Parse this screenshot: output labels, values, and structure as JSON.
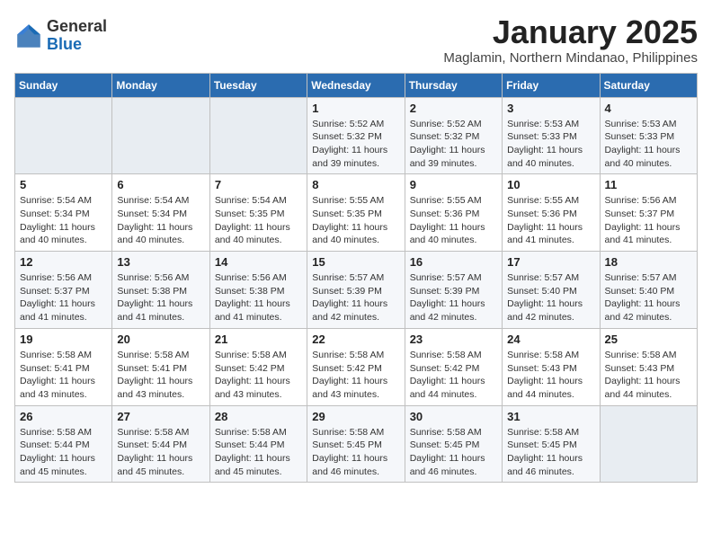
{
  "header": {
    "logo_general": "General",
    "logo_blue": "Blue",
    "month_title": "January 2025",
    "location": "Maglamin, Northern Mindanao, Philippines"
  },
  "days_of_week": [
    "Sunday",
    "Monday",
    "Tuesday",
    "Wednesday",
    "Thursday",
    "Friday",
    "Saturday"
  ],
  "weeks": [
    [
      {
        "day": "",
        "detail": ""
      },
      {
        "day": "",
        "detail": ""
      },
      {
        "day": "",
        "detail": ""
      },
      {
        "day": "1",
        "detail": "Sunrise: 5:52 AM\nSunset: 5:32 PM\nDaylight: 11 hours\nand 39 minutes."
      },
      {
        "day": "2",
        "detail": "Sunrise: 5:52 AM\nSunset: 5:32 PM\nDaylight: 11 hours\nand 39 minutes."
      },
      {
        "day": "3",
        "detail": "Sunrise: 5:53 AM\nSunset: 5:33 PM\nDaylight: 11 hours\nand 40 minutes."
      },
      {
        "day": "4",
        "detail": "Sunrise: 5:53 AM\nSunset: 5:33 PM\nDaylight: 11 hours\nand 40 minutes."
      }
    ],
    [
      {
        "day": "5",
        "detail": "Sunrise: 5:54 AM\nSunset: 5:34 PM\nDaylight: 11 hours\nand 40 minutes."
      },
      {
        "day": "6",
        "detail": "Sunrise: 5:54 AM\nSunset: 5:34 PM\nDaylight: 11 hours\nand 40 minutes."
      },
      {
        "day": "7",
        "detail": "Sunrise: 5:54 AM\nSunset: 5:35 PM\nDaylight: 11 hours\nand 40 minutes."
      },
      {
        "day": "8",
        "detail": "Sunrise: 5:55 AM\nSunset: 5:35 PM\nDaylight: 11 hours\nand 40 minutes."
      },
      {
        "day": "9",
        "detail": "Sunrise: 5:55 AM\nSunset: 5:36 PM\nDaylight: 11 hours\nand 40 minutes."
      },
      {
        "day": "10",
        "detail": "Sunrise: 5:55 AM\nSunset: 5:36 PM\nDaylight: 11 hours\nand 41 minutes."
      },
      {
        "day": "11",
        "detail": "Sunrise: 5:56 AM\nSunset: 5:37 PM\nDaylight: 11 hours\nand 41 minutes."
      }
    ],
    [
      {
        "day": "12",
        "detail": "Sunrise: 5:56 AM\nSunset: 5:37 PM\nDaylight: 11 hours\nand 41 minutes."
      },
      {
        "day": "13",
        "detail": "Sunrise: 5:56 AM\nSunset: 5:38 PM\nDaylight: 11 hours\nand 41 minutes."
      },
      {
        "day": "14",
        "detail": "Sunrise: 5:56 AM\nSunset: 5:38 PM\nDaylight: 11 hours\nand 41 minutes."
      },
      {
        "day": "15",
        "detail": "Sunrise: 5:57 AM\nSunset: 5:39 PM\nDaylight: 11 hours\nand 42 minutes."
      },
      {
        "day": "16",
        "detail": "Sunrise: 5:57 AM\nSunset: 5:39 PM\nDaylight: 11 hours\nand 42 minutes."
      },
      {
        "day": "17",
        "detail": "Sunrise: 5:57 AM\nSunset: 5:40 PM\nDaylight: 11 hours\nand 42 minutes."
      },
      {
        "day": "18",
        "detail": "Sunrise: 5:57 AM\nSunset: 5:40 PM\nDaylight: 11 hours\nand 42 minutes."
      }
    ],
    [
      {
        "day": "19",
        "detail": "Sunrise: 5:58 AM\nSunset: 5:41 PM\nDaylight: 11 hours\nand 43 minutes."
      },
      {
        "day": "20",
        "detail": "Sunrise: 5:58 AM\nSunset: 5:41 PM\nDaylight: 11 hours\nand 43 minutes."
      },
      {
        "day": "21",
        "detail": "Sunrise: 5:58 AM\nSunset: 5:42 PM\nDaylight: 11 hours\nand 43 minutes."
      },
      {
        "day": "22",
        "detail": "Sunrise: 5:58 AM\nSunset: 5:42 PM\nDaylight: 11 hours\nand 43 minutes."
      },
      {
        "day": "23",
        "detail": "Sunrise: 5:58 AM\nSunset: 5:42 PM\nDaylight: 11 hours\nand 44 minutes."
      },
      {
        "day": "24",
        "detail": "Sunrise: 5:58 AM\nSunset: 5:43 PM\nDaylight: 11 hours\nand 44 minutes."
      },
      {
        "day": "25",
        "detail": "Sunrise: 5:58 AM\nSunset: 5:43 PM\nDaylight: 11 hours\nand 44 minutes."
      }
    ],
    [
      {
        "day": "26",
        "detail": "Sunrise: 5:58 AM\nSunset: 5:44 PM\nDaylight: 11 hours\nand 45 minutes."
      },
      {
        "day": "27",
        "detail": "Sunrise: 5:58 AM\nSunset: 5:44 PM\nDaylight: 11 hours\nand 45 minutes."
      },
      {
        "day": "28",
        "detail": "Sunrise: 5:58 AM\nSunset: 5:44 PM\nDaylight: 11 hours\nand 45 minutes."
      },
      {
        "day": "29",
        "detail": "Sunrise: 5:58 AM\nSunset: 5:45 PM\nDaylight: 11 hours\nand 46 minutes."
      },
      {
        "day": "30",
        "detail": "Sunrise: 5:58 AM\nSunset: 5:45 PM\nDaylight: 11 hours\nand 46 minutes."
      },
      {
        "day": "31",
        "detail": "Sunrise: 5:58 AM\nSunset: 5:45 PM\nDaylight: 11 hours\nand 46 minutes."
      },
      {
        "day": "",
        "detail": ""
      }
    ]
  ]
}
